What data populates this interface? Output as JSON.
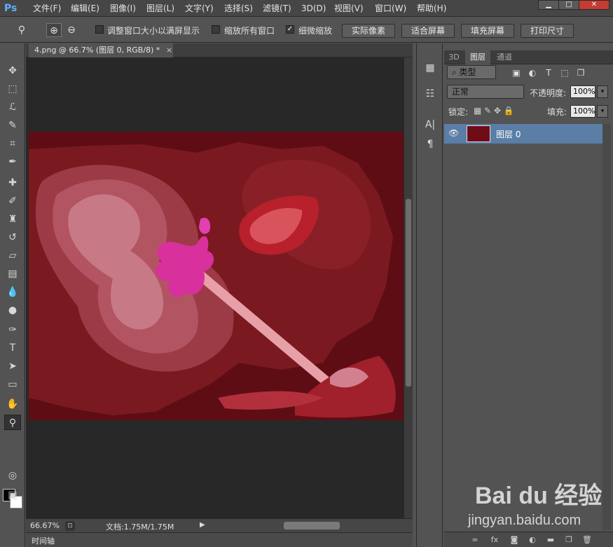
{
  "app": {
    "logo": "Ps"
  },
  "menu": [
    "文件(F)",
    "编辑(E)",
    "图像(I)",
    "图层(L)",
    "文字(Y)",
    "选择(S)",
    "滤镜(T)",
    "3D(D)",
    "视图(V)",
    "窗口(W)",
    "帮助(H)"
  ],
  "window_buttons": {
    "minimize": "▁",
    "maximize": "□",
    "close": "✕"
  },
  "options": {
    "resize_windows": "调整窗口大小以满屏显示",
    "zoom_all": "缩放所有窗口",
    "scrubby_zoom": "细微缩放",
    "actual_pixels": "实际像素",
    "fit_screen": "适合屏幕",
    "fill_screen": "填充屏幕",
    "print_size": "打印尺寸"
  },
  "document": {
    "tab_title": "4.png @ 66.7% (图层 0, RGB/8) *",
    "tab_close": "×",
    "zoom": "66.67%",
    "doc_size": "文档:1.75M/1.75M"
  },
  "timeline": {
    "label": "时间轴"
  },
  "panel": {
    "tabs": [
      "3D",
      "图层",
      "通道"
    ],
    "filter_kind": "类型",
    "blend_mode": "正常",
    "opacity_label": "不透明度:",
    "opacity_value": "100%",
    "lock_label": "锁定:",
    "fill_label": "填充:",
    "fill_value": "100%",
    "layers": [
      {
        "name": "图层 0",
        "visible": true,
        "selected": true
      }
    ]
  },
  "watermark": {
    "brand": "Bai du 经验",
    "url": "jingyan.baidu.com"
  },
  "colors": {
    "accent": "#5a7ea6",
    "canvas_bg": "#282828",
    "ui_bg": "#535353"
  }
}
